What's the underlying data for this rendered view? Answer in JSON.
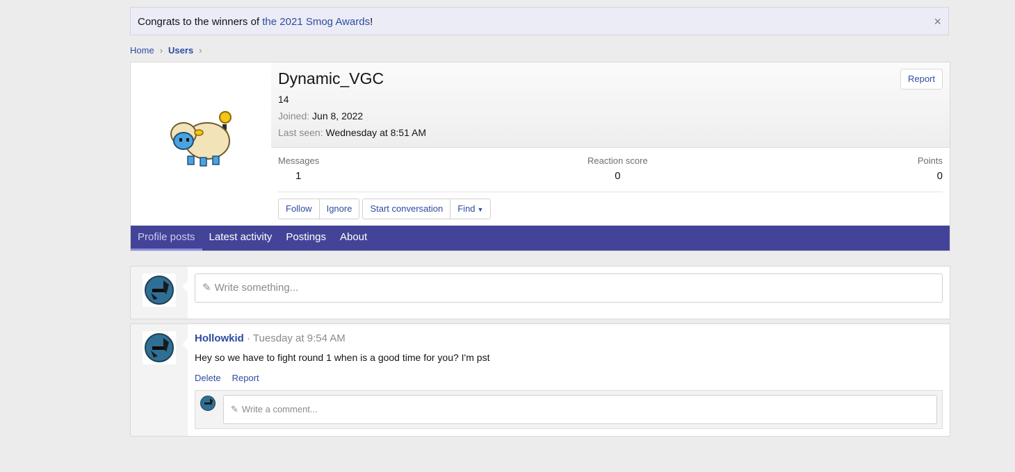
{
  "notice": {
    "text": "Congrats to the winners of ",
    "link": "the 2021 Smog Awards",
    "trail": "!",
    "close": "×"
  },
  "breadcrumb": {
    "home": "Home",
    "users": "Users",
    "sep": "›"
  },
  "profile": {
    "username": "Dynamic_VGC",
    "title": "14",
    "joined_label": "Joined:",
    "joined_value": "Jun 8, 2022",
    "lastseen_label": "Last seen:",
    "lastseen_value": "Wednesday at 8:51 AM",
    "report": "Report",
    "stats": {
      "messages_label": "Messages",
      "messages_value": "1",
      "reaction_label": "Reaction score",
      "reaction_value": "0",
      "points_label": "Points",
      "points_value": "0"
    },
    "actions": {
      "follow": "Follow",
      "ignore": "Ignore",
      "start": "Start conversation",
      "find": "Find"
    }
  },
  "tabs": [
    "Profile posts",
    "Latest activity",
    "Postings",
    "About"
  ],
  "composer": {
    "placeholder": "Write something..."
  },
  "post": {
    "author": "Hollowkid",
    "time": "· Tuesday at 9:54 AM",
    "body": "Hey so we have to fight round 1 when is a good time for you? I'm pst",
    "delete": "Delete",
    "report": "Report",
    "comment_placeholder": "Write a comment..."
  },
  "colors": {
    "accent": "#2d4ca1",
    "tabbar": "#434497"
  }
}
